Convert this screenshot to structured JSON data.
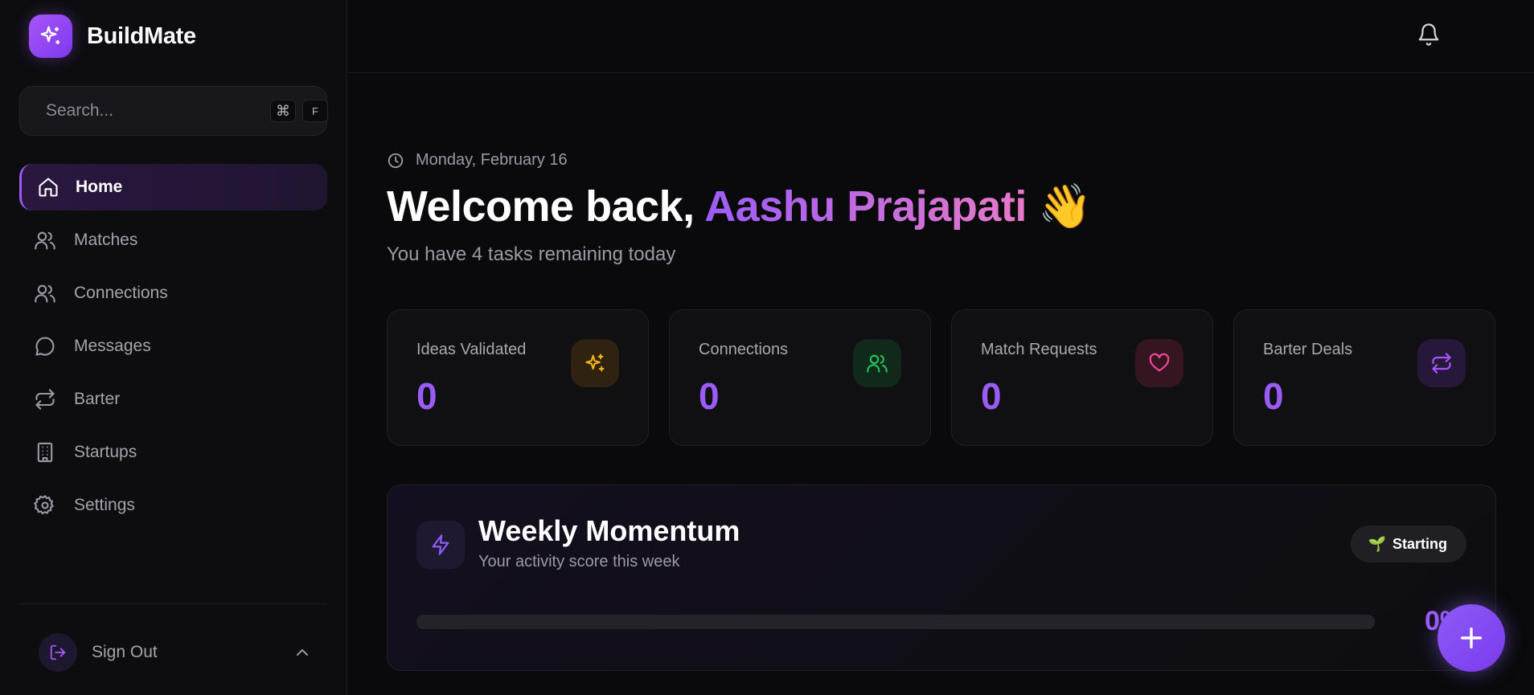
{
  "app": {
    "name": "BuildMate"
  },
  "search": {
    "placeholder": "Search...",
    "shortcut_keys": [
      "⌘",
      "F"
    ]
  },
  "sidebar": {
    "items": [
      {
        "label": "Home",
        "icon": "home-icon",
        "active": true
      },
      {
        "label": "Matches",
        "icon": "users-icon",
        "active": false
      },
      {
        "label": "Connections",
        "icon": "users-icon",
        "active": false
      },
      {
        "label": "Messages",
        "icon": "message-circle-icon",
        "active": false
      },
      {
        "label": "Barter",
        "icon": "repeat-icon",
        "active": false
      },
      {
        "label": "Startups",
        "icon": "building-icon",
        "active": false
      },
      {
        "label": "Settings",
        "icon": "gear-icon",
        "active": false
      }
    ],
    "sign_out_label": "Sign Out"
  },
  "header": {
    "date": "Monday, February 16",
    "welcome_prefix": "Welcome back,",
    "user_name": "Aashu Prajapati",
    "wave_emoji": "👋",
    "subtitle": "You have 4 tasks remaining today"
  },
  "stats": [
    {
      "label": "Ideas Validated",
      "value": "0",
      "icon": "sparkles-icon",
      "color": "#f5b416"
    },
    {
      "label": "Connections",
      "value": "0",
      "icon": "users-icon",
      "color": "#22c55e"
    },
    {
      "label": "Match Requests",
      "value": "0",
      "icon": "heart-icon",
      "color": "#ec4899"
    },
    {
      "label": "Barter Deals",
      "value": "0",
      "icon": "repeat-icon",
      "color": "#a855f7"
    }
  ],
  "momentum": {
    "title": "Weekly Momentum",
    "subtitle": "Your activity score this week",
    "badge_emoji": "🌱",
    "badge_label": "Starting",
    "progress_fraction": 0,
    "progress_text": "0%"
  },
  "colors": {
    "accent": "#9b5cf6",
    "accent_pink": "#e879c9",
    "background": "#0a0a0c"
  }
}
